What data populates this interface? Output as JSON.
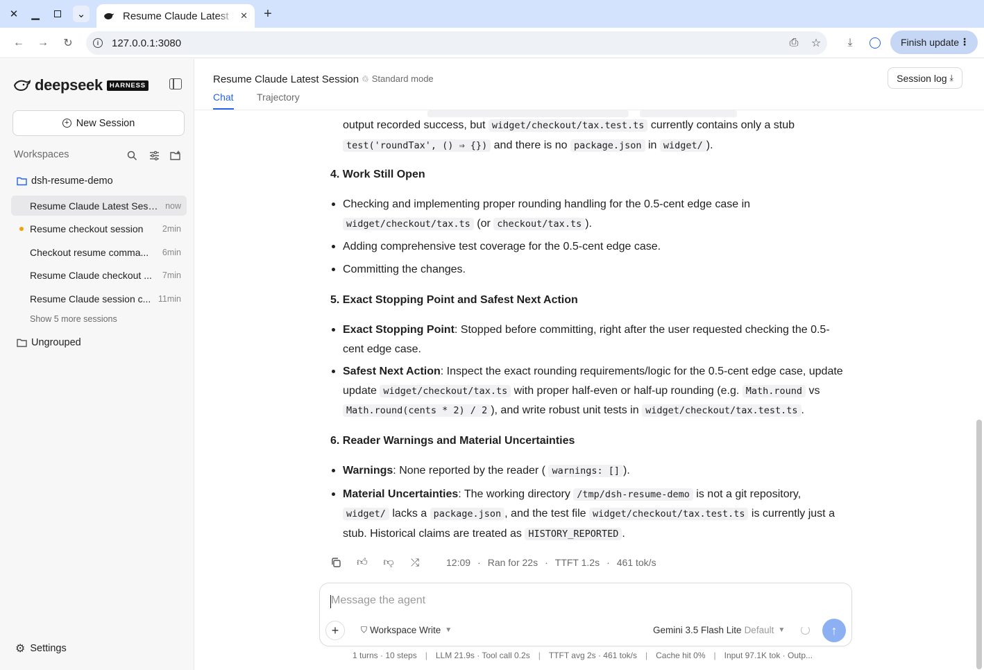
{
  "browser": {
    "tab_title": "Resume Claude Latest Session",
    "url": "127.0.0.1:3080",
    "finish_update": "Finish update"
  },
  "sidebar": {
    "brand": "deepseek",
    "badge": "HARNESS",
    "new_session": "New Session",
    "workspaces_label": "Workspaces",
    "workspace_name": "dsh-resume-demo",
    "sessions": [
      {
        "label": "Resume Claude Latest Sess...",
        "time": "now",
        "active": true
      },
      {
        "label": "Resume checkout session",
        "time": "2min",
        "dot": true
      },
      {
        "label": "Checkout resume comma...",
        "time": "6min"
      },
      {
        "label": "Resume Claude checkout ...",
        "time": "7min"
      },
      {
        "label": "Resume Claude session c...",
        "time": "11min"
      }
    ],
    "show_more": "Show 5 more sessions",
    "ungrouped": "Ungrouped",
    "settings": "Settings"
  },
  "header": {
    "title": "Resume Claude Latest Session",
    "mode": "Standard mode",
    "tabs": [
      "Chat",
      "Trajectory"
    ],
    "session_log": "Session log"
  },
  "message": {
    "p_top_1": "output recorded success, but",
    "p_top_code1": "widget/checkout/tax.test.ts",
    "p_top_2": "currently contains only a stub",
    "p_top_code2": "test('roundTax', () ⇒ {})",
    "p_top_3": "and there is no",
    "p_top_code3": "package.json",
    "p_top_4": "in",
    "p_top_code4": "widget/",
    "p_top_5": ").",
    "h4": "4. Work Still Open",
    "s4": {
      "b1_a": "Checking and implementing proper rounding handling for the 0.5-cent edge case in",
      "b1_code1": "widget/checkout/tax.ts",
      "b1_b": "(or",
      "b1_code2": "checkout/tax.ts",
      "b1_c": ").",
      "b2": "Adding comprehensive test coverage for the 0.5-cent edge case.",
      "b3": "Committing the changes."
    },
    "h5": "5. Exact Stopping Point and Safest Next Action",
    "s5": {
      "b1_bold": "Exact Stopping Point",
      "b1_text": ": Stopped before committing, right after the user requested checking the 0.5-cent edge case.",
      "b2_bold": "Safest Next Action",
      "b2_a": ": Inspect the exact rounding requirements/logic for the 0.5-cent edge case, update",
      "b2_code1": "widget/checkout/tax.ts",
      "b2_b": "with proper half-even or half-up rounding (e.g.",
      "b2_code2": "Math.round",
      "b2_c": "vs",
      "b2_code3": "Math.round(cents * 2) / 2",
      "b2_d": "), and write robust unit tests in",
      "b2_code4": "widget/checkout/tax.test.ts",
      "b2_e": "."
    },
    "h6": "6. Reader Warnings and Material Uncertainties",
    "s6": {
      "b1_bold": "Warnings",
      "b1_a": ": None reported by the reader (",
      "b1_code": "warnings: []",
      "b1_b": ").",
      "b2_bold": "Material Uncertainties",
      "b2_a": ": The working directory",
      "b2_code1": "/tmp/dsh-resume-demo",
      "b2_b": "is not a git repository,",
      "b2_code2": "widget/",
      "b2_c": "lacks a",
      "b2_code3": "package.json",
      "b2_d": ", and the test file",
      "b2_code4": "widget/checkout/tax.test.ts",
      "b2_e": "is currently just a stub. Historical claims are treated as",
      "b2_code5": "HISTORY_REPORTED",
      "b2_f": "."
    }
  },
  "actions": {
    "time": "12:09",
    "ran": "Ran for 22s",
    "ttft": "TTFT 1.2s",
    "speed": "461 tok/s",
    "sep": "·"
  },
  "composer": {
    "placeholder": "Message the agent",
    "workspace_mode": "Workspace Write",
    "model": "Gemini 3.5 Flash Lite",
    "model_default": "Default"
  },
  "status_bar": {
    "turns": "1 turns · 10 steps",
    "llm": "LLM 21.9s · Tool call 0.2s",
    "ttft": "TTFT avg 2s · 461 tok/s",
    "cache": "Cache hit 0%",
    "input": "Input 97.1K tok · Outp...",
    "sep": "|"
  },
  "colors": {
    "accent": "#2563eb",
    "tabbar": "#d3e3fd",
    "send": "#8db0f3",
    "dot": "#f59e0b"
  }
}
